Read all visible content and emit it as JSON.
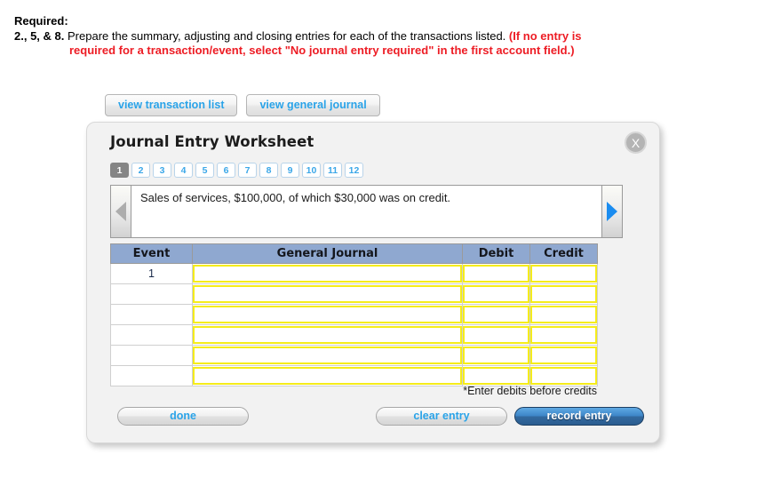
{
  "instructions": {
    "required_label": "Required:",
    "item_number": "2., 5, & 8.",
    "black_text": "Prepare the summary, adjusting and closing entries for each of the transactions listed.",
    "red_text": "(If no entry is required for a transaction/event, select \"No journal entry required\" in the first account field.)",
    "red_color": "#ed1c24"
  },
  "view_buttons": [
    {
      "label": "view transaction list",
      "name": "view-transaction-list-button"
    },
    {
      "label": "view general journal",
      "name": "view-general-journal-button"
    }
  ],
  "panel": {
    "title": "Journal Entry Worksheet",
    "close_icon": "✕",
    "close_label": "X",
    "accent_blue": "#2aa3e8",
    "header_blue": "#8fa8d0",
    "input_border_yellow": "#f5ec1b"
  },
  "entry_tabs": {
    "active_index": 0,
    "items": [
      "1",
      "2",
      "3",
      "4",
      "5",
      "6",
      "7",
      "8",
      "9",
      "10",
      "11",
      "12"
    ]
  },
  "transaction": {
    "description": "Sales of services, $100,000, of which $30,000 was on credit.",
    "prev_arrow": "previous-transaction-arrow",
    "next_arrow": "next-transaction-arrow",
    "prev_enabled": false,
    "next_enabled": true
  },
  "journal": {
    "columns": [
      "Event",
      "General Journal",
      "Debit",
      "Credit"
    ],
    "rows": [
      {
        "event": "1",
        "general_journal": "",
        "debit": "",
        "credit": ""
      },
      {
        "event": "",
        "general_journal": "",
        "debit": "",
        "credit": ""
      },
      {
        "event": "",
        "general_journal": "",
        "debit": "",
        "credit": ""
      },
      {
        "event": "",
        "general_journal": "",
        "debit": "",
        "credit": ""
      },
      {
        "event": "",
        "general_journal": "",
        "debit": "",
        "credit": ""
      },
      {
        "event": "",
        "general_journal": "",
        "debit": "",
        "credit": ""
      }
    ],
    "note": "*Enter debits before credits"
  },
  "footer": {
    "done_label": "done",
    "clear_entry_label": "clear entry",
    "record_entry_label": "record entry"
  }
}
